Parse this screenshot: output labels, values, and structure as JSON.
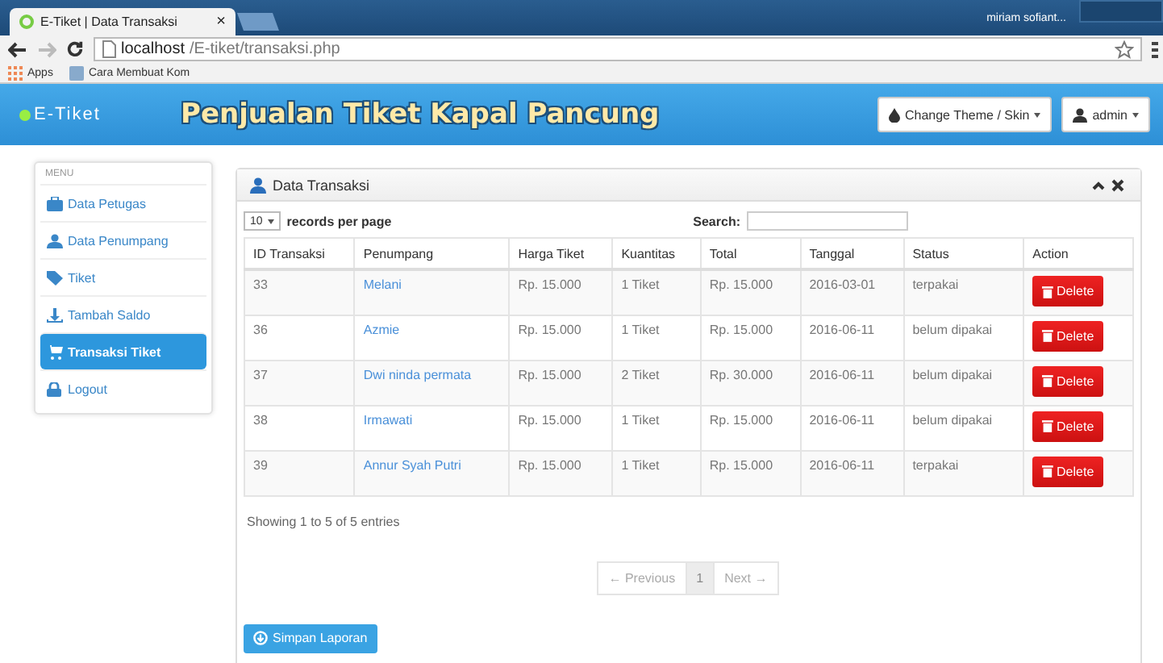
{
  "browser": {
    "tab_title": "E-Tiket | Data Transaksi",
    "tab_close": "×",
    "user": "miriam sofiant...",
    "url_host": "localhost",
    "url_path": "/E-tiket/transaksi.php",
    "bookmarks": [
      {
        "label": "Apps",
        "kind": "apps"
      },
      {
        "label": "Cara Membuat Kom",
        "kind": "page"
      }
    ]
  },
  "header": {
    "brand": "E-Tiket",
    "title": "Penjualan Tiket Kapal Pancung",
    "buttons": [
      {
        "label": "Change Theme / Skin",
        "kind": "theme"
      },
      {
        "label": "admin",
        "kind": "user"
      }
    ]
  },
  "sidebar": {
    "heading": "MENU",
    "items": [
      {
        "label": "Data Petugas",
        "selected": false
      },
      {
        "label": "Data Penumpang",
        "selected": false
      },
      {
        "label": "Tiket",
        "selected": false
      },
      {
        "label": "Tambah Saldo",
        "selected": false
      },
      {
        "label": "Transaksi Tiket",
        "selected": true
      },
      {
        "label": "Logout",
        "selected": false
      }
    ]
  },
  "panel": {
    "title": "Data Transaksi",
    "page_size": "10",
    "page_size_label": "records per page",
    "search_label": "Search:",
    "table": {
      "columns": [
        "ID Transaksi",
        "Penumpang",
        "Harga Tiket",
        "Kuantitas",
        "Total",
        "Tanggal",
        "Status",
        "Action"
      ],
      "rows": [
        [
          "33",
          "Melani",
          "Rp. 15.000",
          "1 Tiket",
          "Rp. 15.000",
          "2016-03-01",
          "terpakai",
          "Delete"
        ],
        [
          "36",
          "Azmie",
          "Rp. 15.000",
          "1 Tiket",
          "Rp. 15.000",
          "2016-06-11",
          "belum dipakai",
          "Delete"
        ],
        [
          "37",
          "Dwi ninda permata",
          "Rp. 15.000",
          "2 Tiket",
          "Rp. 30.000",
          "2016-06-11",
          "belum dipakai",
          "Delete"
        ],
        [
          "38",
          "Irmawati",
          "Rp. 15.000",
          "1 Tiket",
          "Rp. 15.000",
          "2016-06-11",
          "belum dipakai",
          "Delete"
        ],
        [
          "39",
          "Annur Syah Putri",
          "Rp. 15.000",
          "1 Tiket",
          "Rp. 15.000",
          "2016-06-11",
          "terpakai",
          "Delete"
        ]
      ]
    },
    "info": "Showing 1 to 5 of 5 entries",
    "pagination": [
      {
        "label": "← Previous",
        "selected": false
      },
      {
        "label": "1",
        "selected": true
      },
      {
        "label": "Next →",
        "selected": false
      }
    ],
    "save_button": "Simpan Laporan"
  }
}
